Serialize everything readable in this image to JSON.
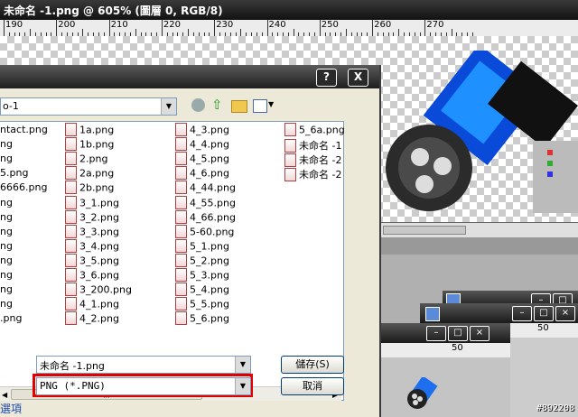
{
  "app": {
    "doc_title": "未命名 -1.png @ 605% (圖層 0, RGB/8)"
  },
  "ruler_top": [
    "190",
    "200",
    "210",
    "220",
    "230",
    "240",
    "250",
    "260",
    "270"
  ],
  "dialog": {
    "help_label": "?",
    "close_label": "X",
    "path_value": "o-1",
    "columns": [
      [
        "ntact.png",
        "ng",
        "ng",
        "5.png",
        "6666.png",
        "ng",
        "ng",
        "ng",
        "ng",
        "ng",
        "ng",
        "ng",
        "ng",
        ".png"
      ],
      [
        "1a.png",
        "1b.png",
        "2.png",
        "2a.png",
        "2b.png",
        "3_1.png",
        "3_2.png",
        "3_3.png",
        "3_4.png",
        "3_5.png",
        "3_6.png",
        "3_200.png",
        "4_1.png",
        "4_2.png"
      ],
      [
        "4_3.png",
        "4_4.png",
        "4_5.png",
        "4_6.png",
        "4_44.png",
        "4_55.png",
        "4_66.png",
        "5-60.png",
        "5_1.png",
        "5_2.png",
        "5_3.png",
        "5_4.png",
        "5_5.png",
        "5_6.png"
      ],
      [
        "5_6a.png",
        "未命名 -1",
        "未命名 -2",
        "未命名 -2"
      ]
    ],
    "filename_value": "未命名 -1.png",
    "filetype_value": "PNG (*.PNG)",
    "save_label": "儲存(S)",
    "cancel_label": "取消",
    "options_label": "選項"
  },
  "windows": {
    "win2_ruler": "50",
    "win3_ruler": "50"
  },
  "watermark": "#892208",
  "colors": {
    "highlight_border": "#e00000",
    "xp_face": "#ece9d8"
  }
}
